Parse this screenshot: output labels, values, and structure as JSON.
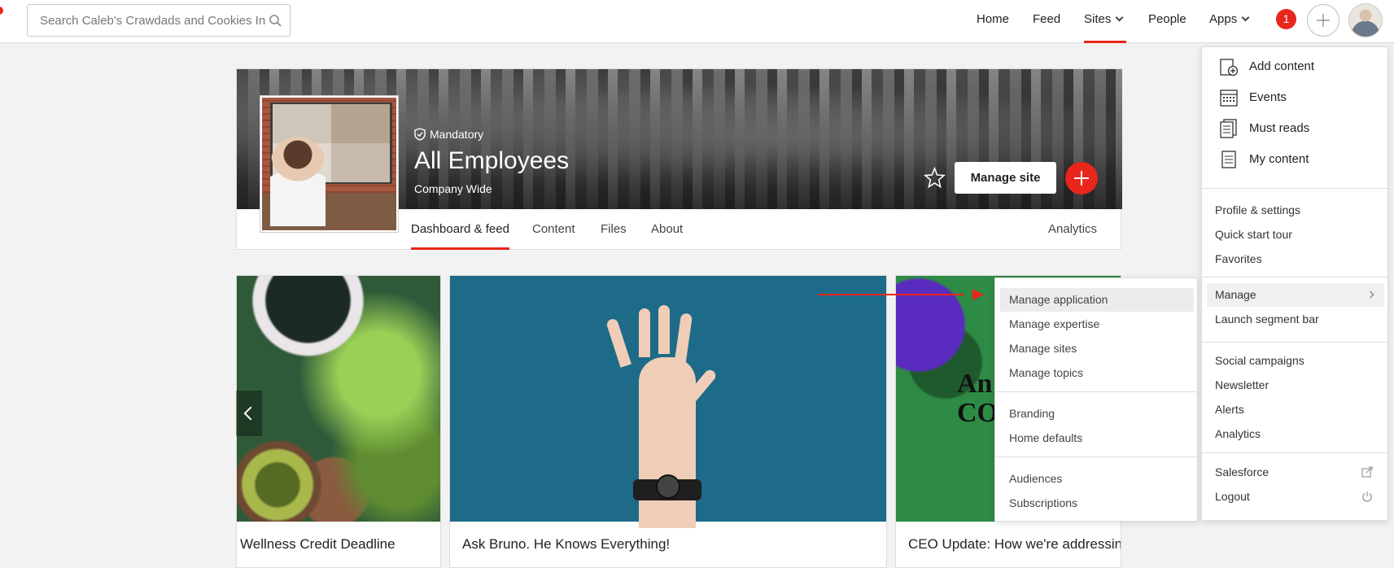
{
  "search": {
    "placeholder": "Search Caleb's Crawdads and Cookies Intranet"
  },
  "nav": {
    "items": [
      {
        "label": "Home"
      },
      {
        "label": "Feed"
      },
      {
        "label": "Sites"
      },
      {
        "label": "People"
      },
      {
        "label": "Apps"
      }
    ],
    "active": "Sites",
    "notification_count": "1"
  },
  "site": {
    "badge": "Mandatory",
    "title": "All Employees",
    "subtitle": "Company Wide",
    "manage_button": "Manage site",
    "tabs": [
      "Dashboard & feed",
      "Content",
      "Files",
      "About"
    ],
    "analytics_tab": "Analytics"
  },
  "carousel": {
    "cards": [
      {
        "title": "Wellness Credit Deadline"
      },
      {
        "title": "Ask Bruno. He Knows Everything!"
      },
      {
        "title": "CEO Update: How we're addressing",
        "overlay_text": "An\nCO"
      }
    ]
  },
  "profile_menu": {
    "primary": [
      {
        "label": "Add content",
        "icon": "add-content-icon"
      },
      {
        "label": "Events",
        "icon": "calendar-icon"
      },
      {
        "label": "Must reads",
        "icon": "must-reads-icon"
      },
      {
        "label": "My content",
        "icon": "document-icon"
      }
    ],
    "section2": [
      "Profile & settings",
      "Quick start tour",
      "Favorites"
    ],
    "section3": [
      "Manage",
      "Launch segment bar"
    ],
    "section4": [
      "Social campaigns",
      "Newsletter",
      "Alerts",
      "Analytics"
    ],
    "section5": [
      "Salesforce",
      "Logout"
    ]
  },
  "manage_submenu": {
    "group1": [
      "Manage application",
      "Manage expertise",
      "Manage sites",
      "Manage topics"
    ],
    "group2": [
      "Branding",
      "Home defaults"
    ],
    "group3": [
      "Audiences",
      "Subscriptions"
    ]
  },
  "colors": {
    "accent": "#e8261c"
  }
}
